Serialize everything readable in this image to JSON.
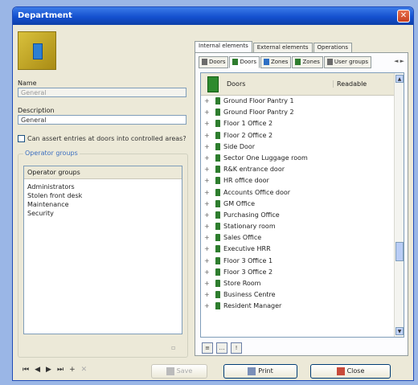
{
  "window": {
    "title": "Department",
    "close_glyph": "✕"
  },
  "general": {
    "name_label": "Name",
    "name_value": "General",
    "description_label": "Description",
    "description_value": "General",
    "checkbox_label": "Can assert entries at doors into controlled areas?",
    "operator_groups_legend": "Operator groups",
    "operator_groups_header": "Operator groups",
    "operator_groups": [
      "Administrators",
      "Stolen front desk",
      "Maintenance",
      "Security"
    ]
  },
  "tabs": {
    "main": [
      "Internal elements",
      "External elements",
      "Operations"
    ],
    "active_main": 0,
    "sub": [
      {
        "label": "Doors",
        "icon": "door-icon"
      },
      {
        "label": "Doors",
        "icon": "door-icon"
      },
      {
        "label": "Zones",
        "icon": "zone-icon"
      },
      {
        "label": "Zones",
        "icon": "zone-icon"
      },
      {
        "label": "User groups",
        "icon": "user-group-icon"
      }
    ],
    "active_sub": 1,
    "scroll_arrows": "◄ ►"
  },
  "door_list": {
    "col_doors": "Doors",
    "col_readable": "Readable",
    "rows": [
      "Ground Floor Pantry 1",
      "Ground Floor Pantry 2",
      "Floor 1 Office 2",
      "Floor 2 Office 2",
      "Side Door",
      "Sector One Luggage room",
      "R&K entrance door",
      "HR office door",
      "Accounts Office door",
      "GM Office",
      "Purchasing Office",
      "Stationary room",
      "Sales Office",
      "Executive HRR",
      "Floor 3 Office 1",
      "Floor 3 Office 2",
      "Store Room",
      "Business Centre",
      "Resident Manager"
    ],
    "expander": "+"
  },
  "list_tools": [
    "≡",
    "…",
    "!"
  ],
  "navigation": [
    "⏮",
    "◀",
    "▶",
    "⏭",
    "+",
    "✕"
  ],
  "footer": {
    "save_label": "Save",
    "print_label": "Print",
    "close_label": "Close"
  },
  "colors": {
    "titlebar": "#1450cf",
    "window_bg": "#ece9d8",
    "desktop": "#9ab6e6",
    "door_icon": "#2e7d2e"
  }
}
